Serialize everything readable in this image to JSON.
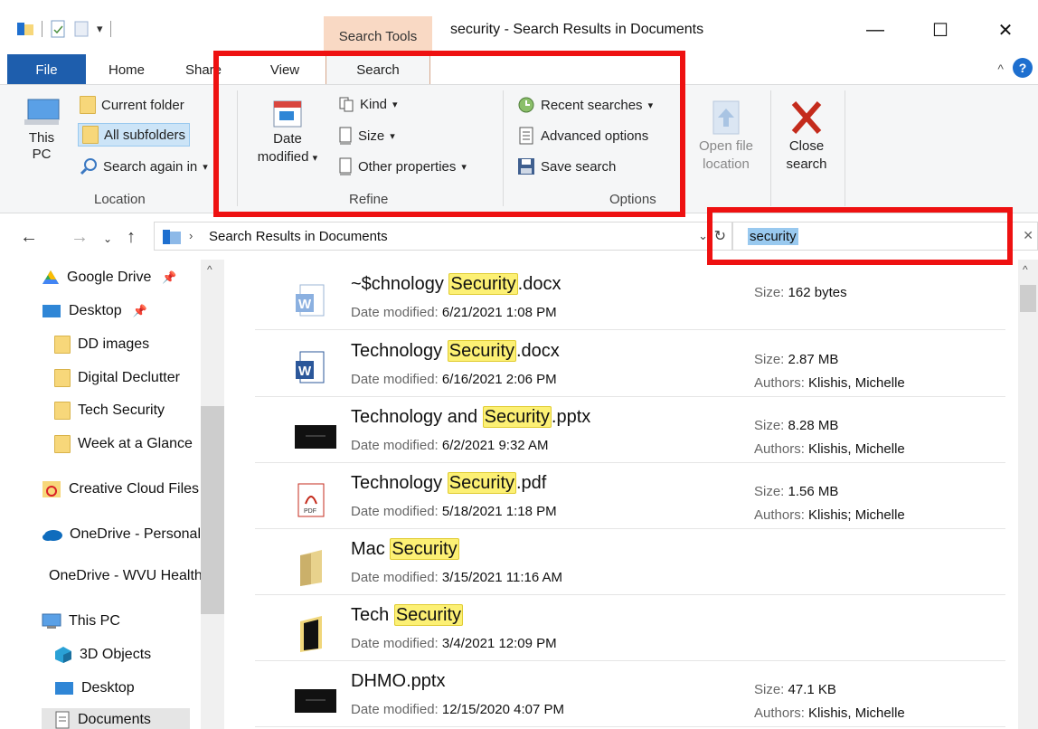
{
  "window": {
    "context_tab": "Search Tools",
    "title": "security - Search Results in Documents",
    "minimize": "—",
    "maximize": "☐",
    "close": "✕"
  },
  "tabs": {
    "file": "File",
    "home": "Home",
    "share": "Share",
    "view": "View",
    "search": "Search"
  },
  "ribbon": {
    "location": {
      "this_pc": "This\nPC",
      "current_folder": "Current folder",
      "all_subfolders": "All subfolders",
      "search_again": "Search again in",
      "label": "Location"
    },
    "refine": {
      "date_modified": "Date",
      "date_modified2": "modified",
      "kind": "Kind",
      "size": "Size",
      "other_properties": "Other properties",
      "label": "Refine"
    },
    "options": {
      "recent_searches": "Recent searches",
      "advanced_options": "Advanced options",
      "save_search": "Save search",
      "label": "Options"
    },
    "open_file_location": "Open file",
    "open_file_location2": "location",
    "close_search": "Close",
    "close_search2": "search"
  },
  "address": {
    "path": "Search Results in Documents",
    "search_value": "security"
  },
  "nav_pane": {
    "items": [
      {
        "label": "Google Drive",
        "icon": "google-drive-icon"
      },
      {
        "label": "Desktop",
        "icon": "desktop-icon"
      },
      {
        "label": "DD images",
        "icon": "folder-icon"
      },
      {
        "label": "Digital Declutter",
        "icon": "folder-icon"
      },
      {
        "label": "Tech Security",
        "icon": "folder-icon"
      },
      {
        "label": "Week at a Glance",
        "icon": "folder-icon"
      },
      {
        "label": "Creative Cloud Files",
        "icon": "creative-cloud-icon"
      },
      {
        "label": "OneDrive - Personal",
        "icon": "onedrive-icon"
      },
      {
        "label": "OneDrive - WVU Health",
        "icon": "onedrive-icon"
      },
      {
        "label": "This PC",
        "icon": "this-pc-icon"
      },
      {
        "label": "3D Objects",
        "icon": "3d-objects-icon"
      },
      {
        "label": "Desktop",
        "icon": "desktop-icon"
      },
      {
        "label": "Documents",
        "icon": "documents-icon"
      }
    ]
  },
  "results": {
    "date_label": "Date modified:",
    "size_label": "Size:",
    "authors_label": "Authors:",
    "items": [
      {
        "pre": "~$chnology ",
        "hl": "Security",
        "post": ".docx",
        "date": "6/21/2021 1:08 PM",
        "size": "162 bytes",
        "authors": "",
        "type": "word-temp"
      },
      {
        "pre": "Technology ",
        "hl": "Security",
        "post": ".docx",
        "date": "6/16/2021 2:06 PM",
        "size": "2.87 MB",
        "authors": "Klishis, Michelle",
        "type": "word"
      },
      {
        "pre": "Technology and ",
        "hl": "Security",
        "post": ".pptx",
        "date": "6/2/2021 9:32 AM",
        "size": "8.28 MB",
        "authors": "Klishis, Michelle",
        "type": "pptx"
      },
      {
        "pre": "Technology ",
        "hl": "Security",
        "post": ".pdf",
        "date": "5/18/2021 1:18 PM",
        "size": "1.56 MB",
        "authors": "Klishis; Michelle",
        "type": "pdf"
      },
      {
        "pre": "Mac ",
        "hl": "Security",
        "post": "",
        "date": "3/15/2021 11:16 AM",
        "size": "",
        "authors": "",
        "type": "folder"
      },
      {
        "pre": "Tech ",
        "hl": "Security",
        "post": "",
        "date": "3/4/2021 12:09 PM",
        "size": "",
        "authors": "",
        "type": "folder-dark"
      },
      {
        "pre": "DHMO.pptx",
        "hl": "",
        "post": "",
        "date": "12/15/2020 4:07 PM",
        "size": "47.1 KB",
        "authors": "Klishis, Michelle",
        "type": "pptx"
      }
    ]
  },
  "colors": {
    "accent": "#1e5ead",
    "highlight": "#fcf074",
    "annotation": "#ee1111",
    "context_tab": "#f9d9c4"
  }
}
